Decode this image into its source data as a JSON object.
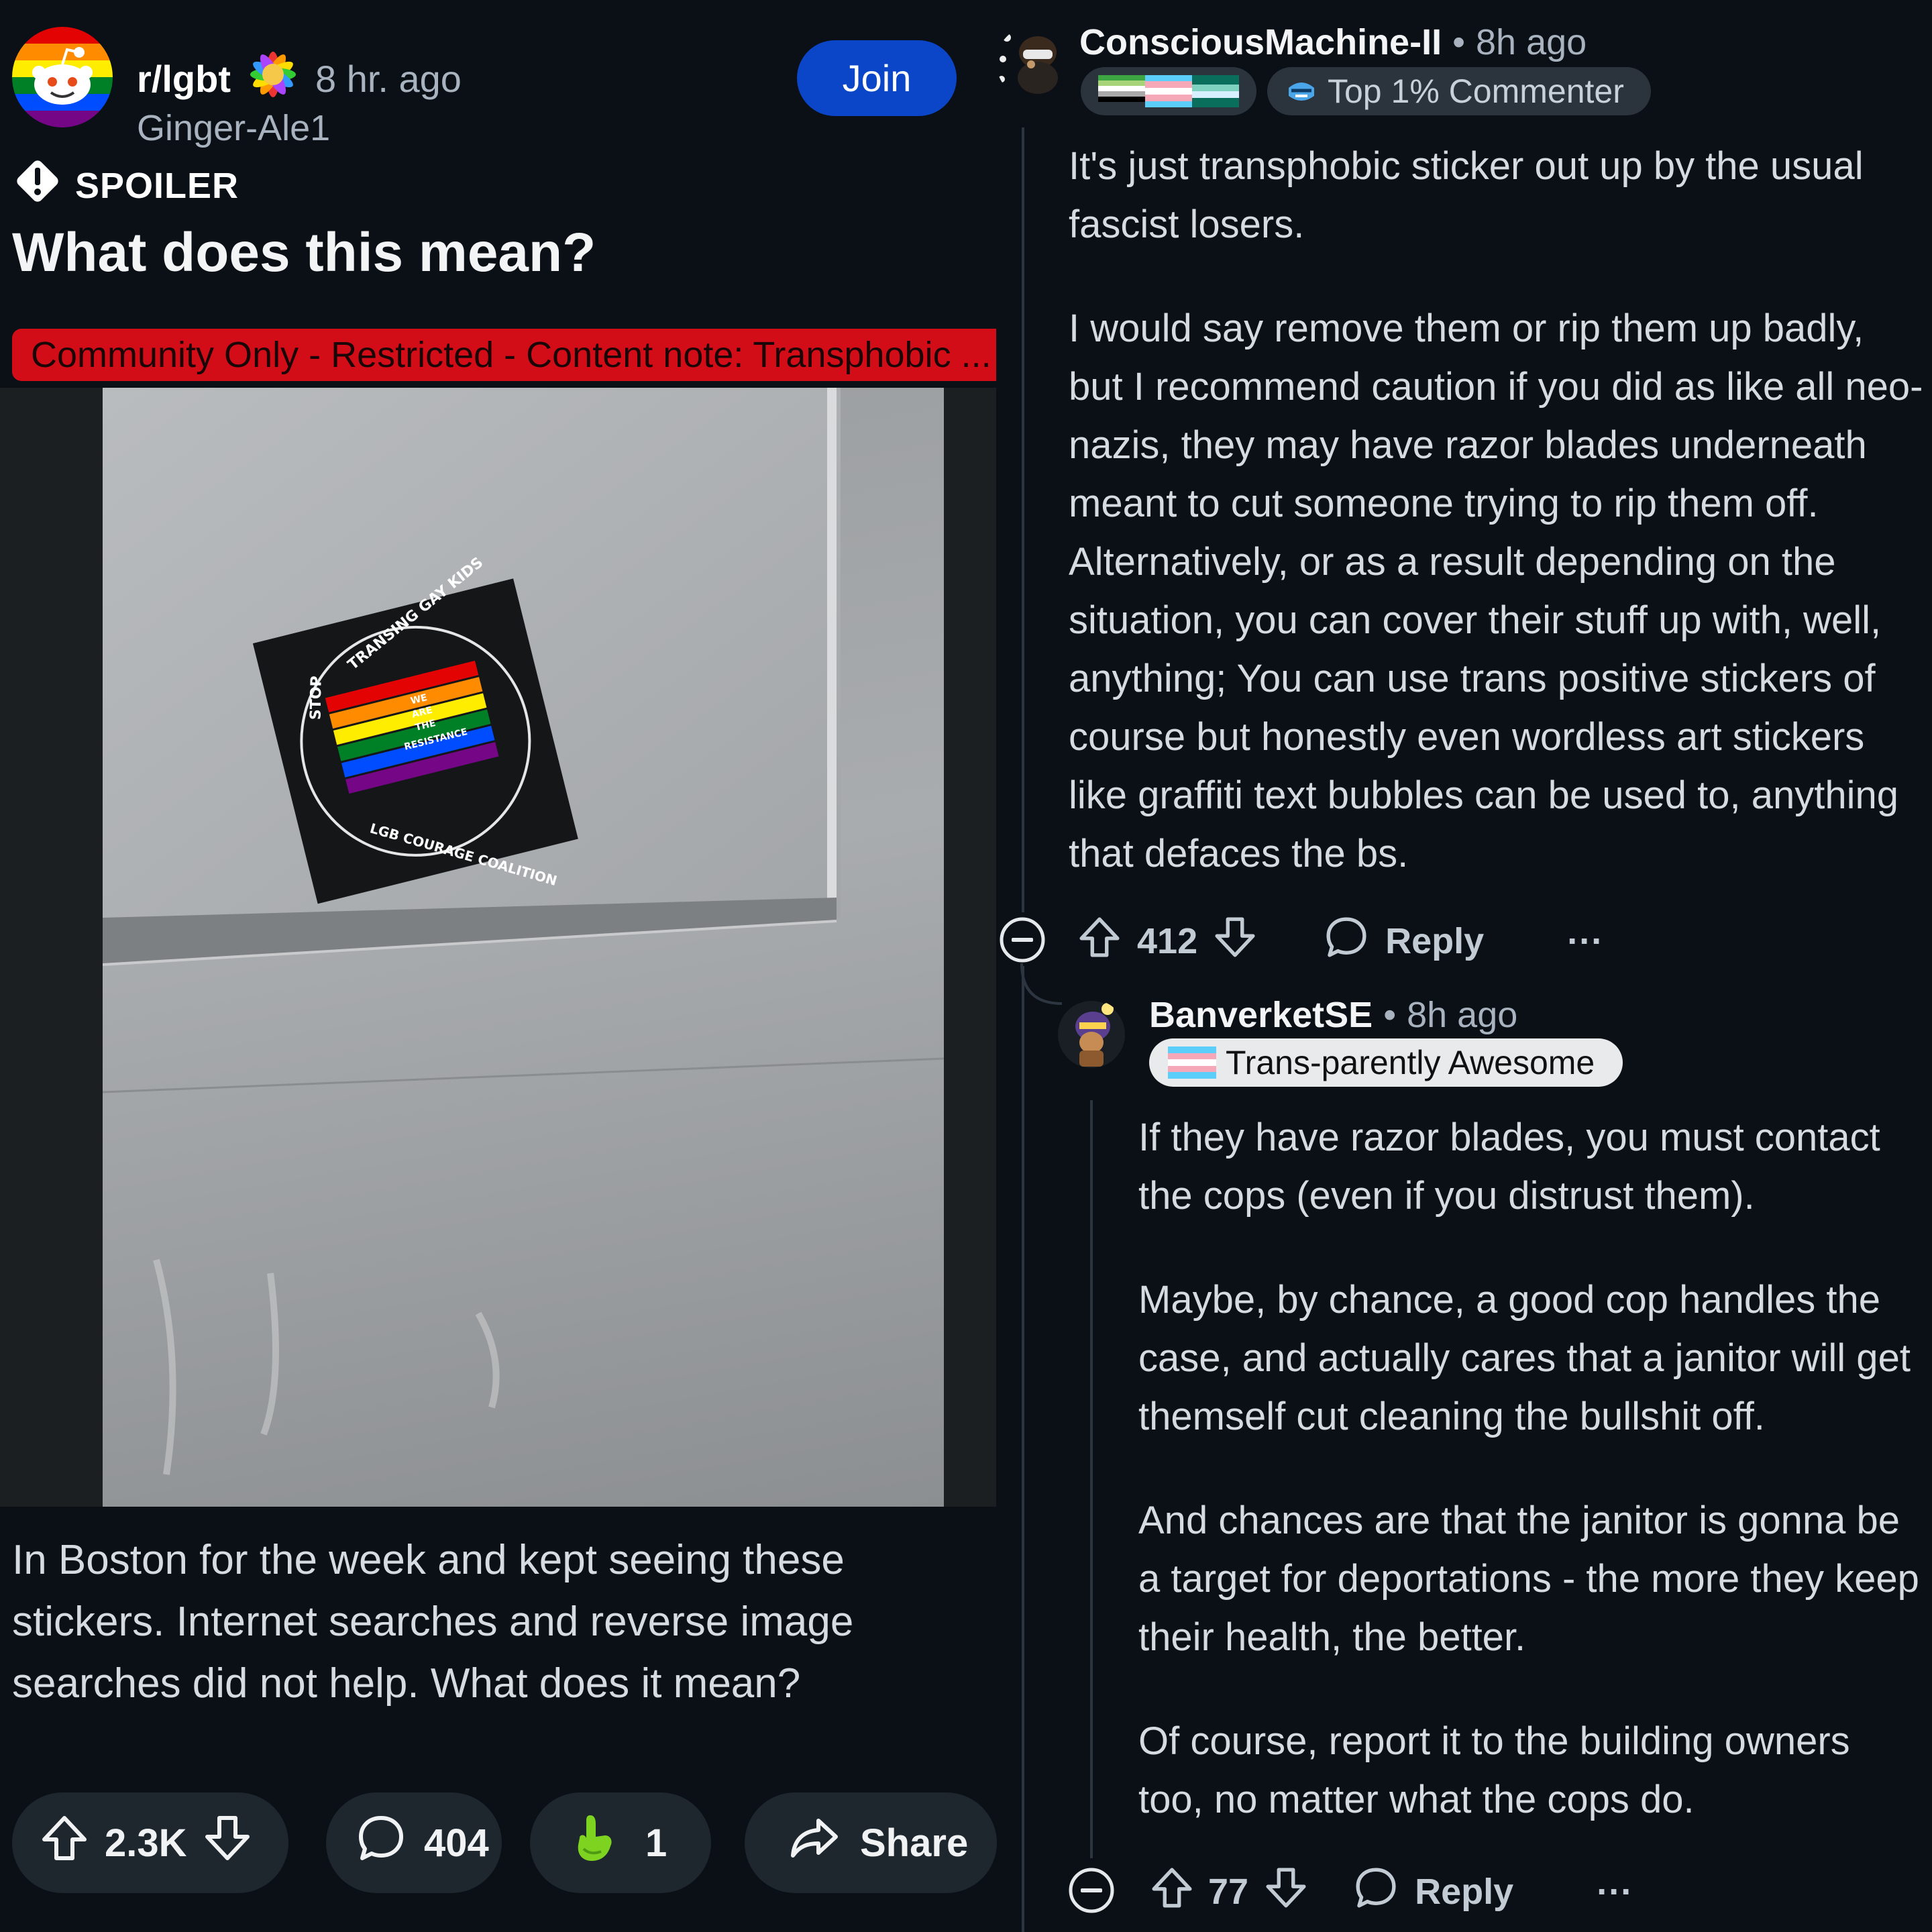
{
  "post": {
    "subreddit": "r/lgbt",
    "time_ago": "8 hr. ago",
    "author": "Ginger-Ale1",
    "join_label": "Join",
    "spoiler_label": "SPOILER",
    "title": "What does this mean?",
    "flair": "Community Only - Restricted - Content note: Transphobic ...",
    "sticker_text_top": "TRANSING GAY KIDS",
    "sticker_text_left": "STOP",
    "sticker_text_bottom": "LGB COURAGE COALITION",
    "sticker_text_center": [
      "WE",
      "ARE",
      "THE",
      "RESISTANCE"
    ],
    "body": "In Boston for the week and kept seeing these stickers. Internet searches and reverse image searches did not help. What does it mean?",
    "upvotes": "2.3K",
    "comments": "404",
    "awards": "1",
    "share_label": "Share"
  },
  "comment1": {
    "username": "ConsciousMachine-II",
    "time_ago": "8h ago",
    "badge": "Top 1% Commenter",
    "paragraphs": [
      "It's just transphobic sticker out up by the usual fascist losers.",
      "I would say remove them or rip them up badly, but I recommend caution if you did as like all neo-nazis, they may have razor blades underneath meant to cut someone trying to rip them off. Alternatively, or as a result depending on the situation, you can cover their stuff up with, well, anything; You can use trans positive stickers of course but honestly even wordless art stickers like graffiti text bubbles can be used to, anything that defaces the bs."
    ],
    "score": "412",
    "reply_label": "Reply",
    "more_label": "···"
  },
  "comment2": {
    "username": "BanverketSE",
    "time_ago": "8h ago",
    "flair": "Trans-parently Awesome",
    "paragraphs": [
      "If they have razor blades, you must contact the cops (even if you distrust them).",
      "Maybe, by chance, a good cop handles the case, and actually cares that a janitor will get themself cut cleaning the bullshit off.",
      "And chances are that the janitor is gonna be a target for deportations - the more they keep their health, the better.",
      "Of course, report it to the building owners too, no matter what the cops do."
    ],
    "score": "77",
    "reply_label": "Reply",
    "more_label": "···"
  },
  "colors": {
    "background": "#0b1016",
    "join_button": "#0b45c8",
    "flair_red": "#d20d18",
    "pill": "#1f272e",
    "muted_text": "#a8b3bf",
    "body_text": "#d5dbe1",
    "award_green": "#7ed321"
  },
  "icons": {
    "spoiler": "exclamation-diamond-icon",
    "upvote": "arrow-up-icon",
    "downvote": "arrow-down-icon",
    "comment": "speech-bubble-icon",
    "award": "hand-award-icon",
    "share": "share-arrow-icon",
    "collapse": "minus-circle-icon",
    "more": "ellipsis-icon"
  }
}
